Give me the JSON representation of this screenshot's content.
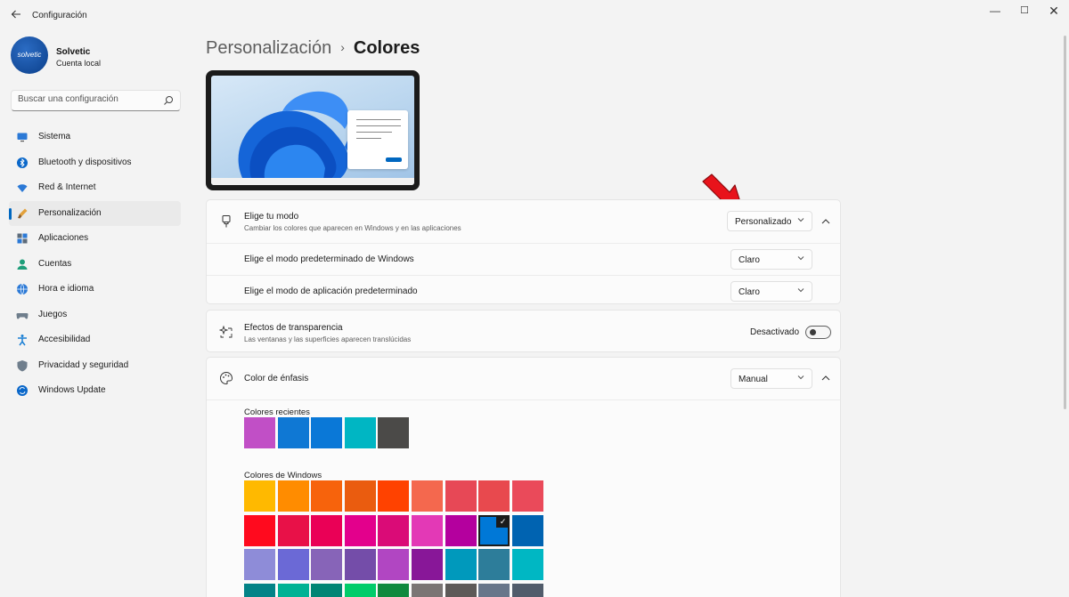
{
  "window": {
    "back_icon": "back-arrow-icon",
    "title": "Configuración",
    "controls": {
      "minimize": "—",
      "maximize": "☐",
      "close": "✕"
    }
  },
  "profile": {
    "avatar_text": "solvetic",
    "name": "Solvetic",
    "account_type": "Cuenta local"
  },
  "search": {
    "placeholder": "Buscar una configuración"
  },
  "sidebar": {
    "items": [
      {
        "label": "Sistema",
        "icon": "monitor-icon",
        "active": false
      },
      {
        "label": "Bluetooth y dispositivos",
        "icon": "bluetooth-icon",
        "active": false
      },
      {
        "label": "Red & Internet",
        "icon": "wifi-icon",
        "active": false
      },
      {
        "label": "Personalización",
        "icon": "paint-brush-icon",
        "active": true
      },
      {
        "label": "Aplicaciones",
        "icon": "apps-grid-icon",
        "active": false
      },
      {
        "label": "Cuentas",
        "icon": "person-icon",
        "active": false
      },
      {
        "label": "Hora e idioma",
        "icon": "globe-clock-icon",
        "active": false
      },
      {
        "label": "Juegos",
        "icon": "gamepad-icon",
        "active": false
      },
      {
        "label": "Accesibilidad",
        "icon": "accessibility-icon",
        "active": false
      },
      {
        "label": "Privacidad y seguridad",
        "icon": "shield-icon",
        "active": false
      },
      {
        "label": "Windows Update",
        "icon": "sync-icon",
        "active": false
      }
    ]
  },
  "header": {
    "parent": "Personalización",
    "separator": "›",
    "current": "Colores"
  },
  "mode_card": {
    "title": "Elige tu modo",
    "description": "Cambiar los colores que aparecen en Windows y en las aplicaciones",
    "value": "Personalizado",
    "windows_mode_label": "Elige el modo predeterminado de Windows",
    "windows_mode_value": "Claro",
    "app_mode_label": "Elige el modo de aplicación predeterminado",
    "app_mode_value": "Claro"
  },
  "transparency_card": {
    "title": "Efectos de transparencia",
    "description": "Las ventanas y las superficies aparecen translúcidas",
    "state_label": "Desactivado",
    "enabled": false
  },
  "accent_card": {
    "title": "Color de énfasis",
    "value": "Manual",
    "recent_label": "Colores recientes",
    "recent_colors": [
      "#c14fc6",
      "#0f78d4",
      "#0a78d7",
      "#00b6c3",
      "#4b4a48"
    ],
    "windows_label": "Colores de Windows",
    "windows_colors": [
      [
        "#ffb900",
        "#ff8c00",
        "#f7630c",
        "#ea5c0f",
        "#ff4200",
        "#f4684e",
        "#e74856",
        "#e8494e",
        "#ea4a5a"
      ],
      [
        "#ff0a1e",
        "#e81148",
        "#ea0056",
        "#e3008c",
        "#da0b77",
        "#e339b6",
        "#b4009e",
        "#0078d7",
        "#0063b1"
      ],
      [
        "#8e8cd8",
        "#6b69d6",
        "#8764b8",
        "#744da9",
        "#b146c2",
        "#881798",
        "#0099bc",
        "#2d7d9a",
        "#00b7c3"
      ],
      [
        "#038387",
        "#00b294",
        "#018574",
        "#00cc6a",
        "#10893e",
        "#7a7574",
        "#5d5a58",
        "#68768a",
        "#515c6b"
      ]
    ],
    "selected_index": [
      1,
      7
    ],
    "selected_mark": "✓"
  }
}
